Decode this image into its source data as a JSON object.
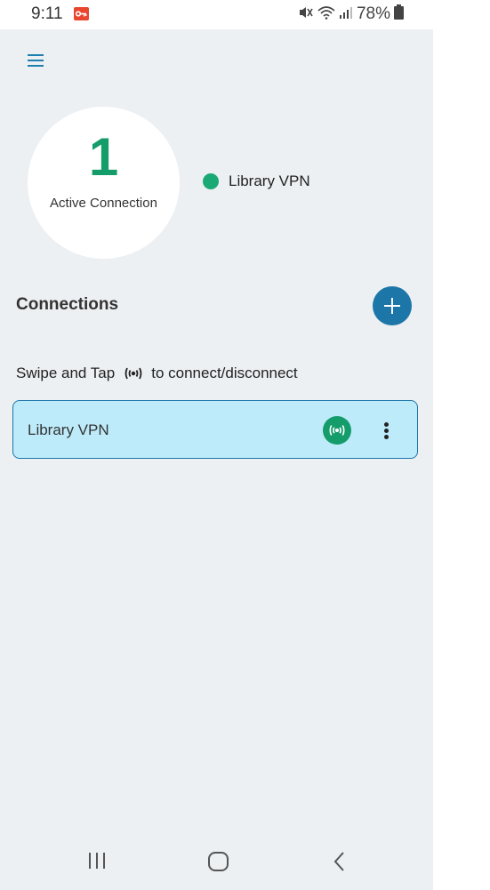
{
  "status_bar": {
    "time": "9:11",
    "battery": "78%",
    "icons": [
      "app-notification-icon",
      "mute-icon",
      "wifi-icon",
      "signal-icon",
      "battery-icon"
    ]
  },
  "toolbar": {
    "menu_icon": "hamburger-menu-icon"
  },
  "summary": {
    "active_count": "1",
    "active_label": "Active Connection",
    "active_items": [
      {
        "name": "Library VPN",
        "status_color": "#19a974"
      }
    ]
  },
  "connections": {
    "title": "Connections",
    "add_icon": "plus-icon",
    "hint_prefix": "Swipe and Tap",
    "hint_icon": "broadcast-icon",
    "hint_suffix": "to connect/disconnect",
    "items": [
      {
        "name": "Library VPN",
        "connect_icon": "broadcast-icon",
        "menu_icon": "more-vertical-icon"
      }
    ]
  },
  "nav_bar": {
    "icons": [
      "recent-apps-icon",
      "home-icon",
      "back-icon"
    ]
  },
  "colors": {
    "accent": "#1c76a8",
    "connected_green": "#149c6b",
    "card_background": "#bdebfa",
    "screen_background": "#edf0f3"
  }
}
